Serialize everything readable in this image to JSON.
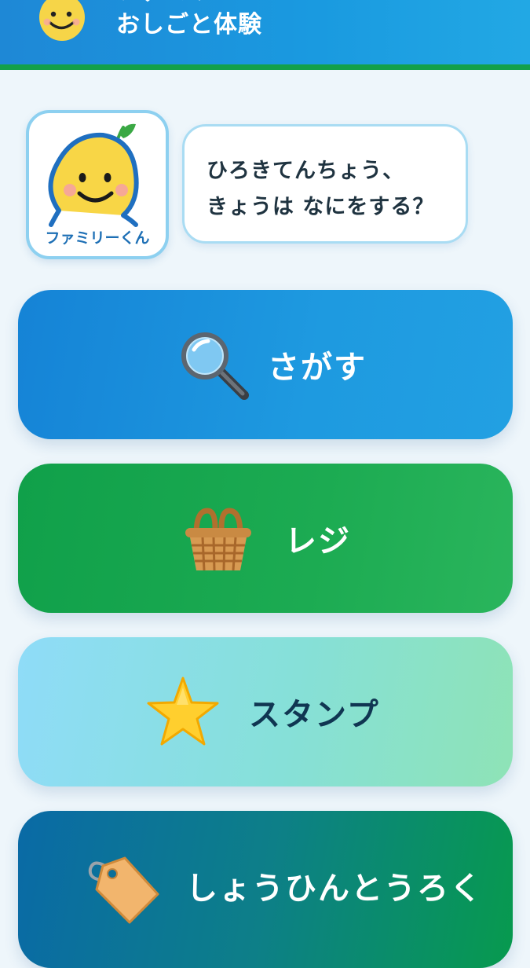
{
  "header": {
    "title_top_partial": "ファミリー",
    "title": "おしごと体験",
    "logo_icon": "smiling-mascot-icon"
  },
  "mascot": {
    "name": "ファミリーくん",
    "icon": "fruit-mascot-icon"
  },
  "speech_bubble": {
    "line1": "ひろきてんちょう、",
    "line2": "きょうは なにをする？"
  },
  "menu": {
    "search": {
      "label": "さがす",
      "icon": "magnifying-glass-icon",
      "color": "#1a8fdc"
    },
    "register": {
      "label": "レジ",
      "icon": "basket-icon",
      "color": "#16a34e"
    },
    "stamp": {
      "label": "スタンプ",
      "icon": "star-icon",
      "color": "#8ee0d0"
    },
    "product_registration": {
      "label": "しょうひんとうろく",
      "icon": "price-tag-icon",
      "color": "#0b7d86"
    }
  }
}
